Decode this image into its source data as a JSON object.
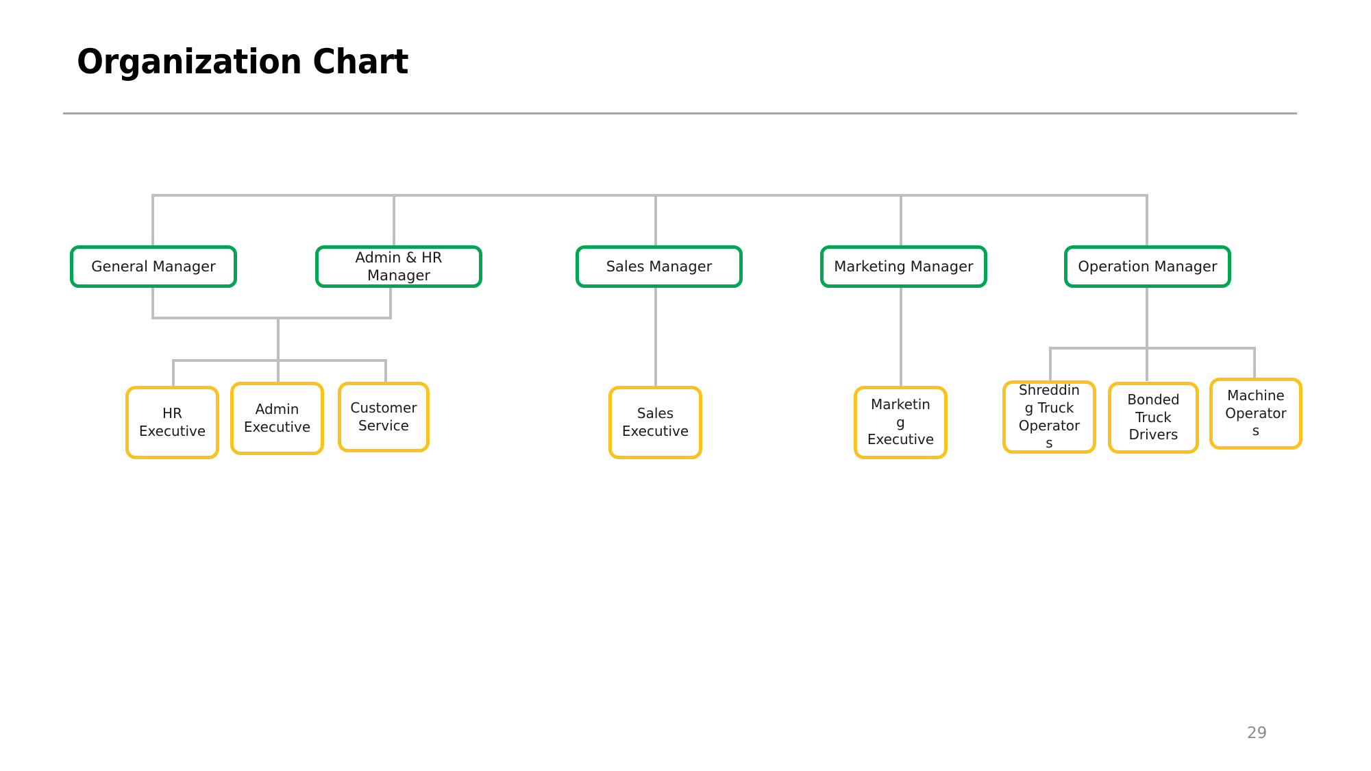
{
  "slide": {
    "title": "Organization Chart",
    "page_number": "29",
    "background_color": "#ffffff"
  },
  "colors": {
    "manager_border": "#00a651",
    "executive_border": "#fbc11c",
    "connector": "#bfbfbf",
    "divider": "#a6a6a6",
    "title_text": "#000000",
    "node_text": "#1a1a1a",
    "page_number_text": "#8c8c8c"
  },
  "chart_data": {
    "type": "diagram",
    "title": "Organization Chart",
    "diagram_kind": "organization-chart",
    "levels": 2,
    "nodes": [
      {
        "id": "general-manager",
        "label": "General Manager",
        "level": 1,
        "style": "manager"
      },
      {
        "id": "admin-hr-manager",
        "label": "Admin & HR Manager",
        "level": 1,
        "style": "manager"
      },
      {
        "id": "sales-manager",
        "label": "Sales Manager",
        "level": 1,
        "style": "manager"
      },
      {
        "id": "marketing-manager",
        "label": "Marketing Manager",
        "level": 1,
        "style": "manager"
      },
      {
        "id": "operation-manager",
        "label": "Operation Manager",
        "level": 1,
        "style": "manager"
      },
      {
        "id": "hr-executive",
        "label": "HR\nExecutive",
        "level": 2,
        "style": "executive"
      },
      {
        "id": "admin-executive",
        "label": "Admin\nExecutive",
        "level": 2,
        "style": "executive"
      },
      {
        "id": "customer-service",
        "label": "Customer\nService",
        "level": 2,
        "style": "executive"
      },
      {
        "id": "sales-executive",
        "label": "Sales\nExecutive",
        "level": 2,
        "style": "executive"
      },
      {
        "id": "marketing-executive",
        "label": "Marketin\ng\nExecutive",
        "level": 2,
        "style": "executive"
      },
      {
        "id": "shredding-truck-operators",
        "label": "Shreddin\ng Truck\nOperator\ns",
        "level": 2,
        "style": "executive"
      },
      {
        "id": "bonded-truck-drivers",
        "label": "Bonded\nTruck\nDrivers",
        "level": 2,
        "style": "executive"
      },
      {
        "id": "machine-operators",
        "label": "Machine\nOperator\ns",
        "level": 2,
        "style": "executive"
      }
    ],
    "edges": [
      {
        "from": "top-bus",
        "to": "general-manager"
      },
      {
        "from": "top-bus",
        "to": "admin-hr-manager"
      },
      {
        "from": "top-bus",
        "to": "sales-manager"
      },
      {
        "from": "top-bus",
        "to": "marketing-manager"
      },
      {
        "from": "top-bus",
        "to": "operation-manager"
      },
      {
        "from": "general-manager",
        "to": "hr-executive"
      },
      {
        "from": "general-manager",
        "to": "admin-executive"
      },
      {
        "from": "general-manager",
        "to": "customer-service"
      },
      {
        "from": "admin-hr-manager",
        "to": "hr-executive"
      },
      {
        "from": "admin-hr-manager",
        "to": "admin-executive"
      },
      {
        "from": "admin-hr-manager",
        "to": "customer-service"
      },
      {
        "from": "sales-manager",
        "to": "sales-executive"
      },
      {
        "from": "marketing-manager",
        "to": "marketing-executive"
      },
      {
        "from": "operation-manager",
        "to": "shredding-truck-operators"
      },
      {
        "from": "operation-manager",
        "to": "bonded-truck-drivers"
      },
      {
        "from": "operation-manager",
        "to": "machine-operators"
      }
    ]
  },
  "managers": {
    "general": "General Manager",
    "admin_hr": "Admin & HR Manager",
    "sales": "Sales Manager",
    "marketing": "Marketing Manager",
    "operation": "Operation Manager"
  },
  "executives": {
    "hr": "HR\nExecutive",
    "admin": "Admin\nExecutive",
    "customer_service": "Customer\nService",
    "sales": "Sales\nExecutive",
    "marketing": "Marketin\ng\nExecutive",
    "shredding_truck_operators": "Shreddin\ng Truck\nOperator\ns",
    "bonded_truck_drivers": "Bonded\nTruck\nDrivers",
    "machine_operators": "Machine\nOperator\ns"
  }
}
